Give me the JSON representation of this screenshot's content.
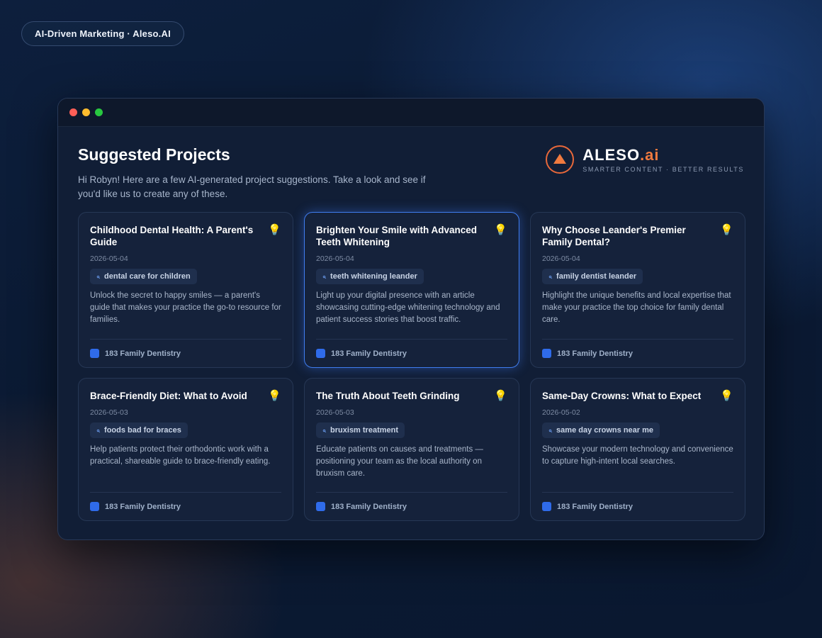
{
  "top_pill": {
    "label": "AI-Driven Marketing · Aleso.AI"
  },
  "window": {
    "traffic_lights": [
      "red",
      "yellow",
      "green"
    ]
  },
  "header": {
    "title": "Suggested Projects",
    "subtitle": "Hi Robyn! Here are a few AI-generated project suggestions. Take a look and see if you'd like us to create any of these."
  },
  "logo": {
    "name": "ALESO",
    "suffix": ".ai",
    "tagline": "SMARTER CONTENT · BETTER RESULTS",
    "icon": "triangle-logo-icon"
  },
  "colors": {
    "accent": "#3f7df0",
    "brand_orange": "#f07a3f",
    "card_bg": "#15223b",
    "window_bg": "#111e36"
  },
  "cards": [
    {
      "title": "Childhood Dental Health: A Parent's Guide",
      "date": "2026-05-04",
      "keyword": "dental care for children",
      "description": "Unlock the secret to happy smiles — a parent's guide that makes your practice the go-to resource for families.",
      "client": "183 Family Dentistry",
      "icon": "lightbulb-icon",
      "selected": false
    },
    {
      "title": "Brighten Your Smile with Advanced Teeth Whitening",
      "date": "2026-05-04",
      "keyword": "teeth whitening leander",
      "description": "Light up your digital presence with an article showcasing cutting-edge whitening technology and patient success stories that boost traffic.",
      "client": "183 Family Dentistry",
      "icon": "lightbulb-icon",
      "selected": true
    },
    {
      "title": "Why Choose Leander's Premier Family Dental?",
      "date": "2026-05-04",
      "keyword": "family dentist leander",
      "description": "Highlight the unique benefits and local expertise that make your practice the top choice for family dental care.",
      "client": "183 Family Dentistry",
      "icon": "lightbulb-icon",
      "selected": false
    },
    {
      "title": "Brace-Friendly Diet: What to Avoid",
      "date": "2026-05-03",
      "keyword": "foods bad for braces",
      "description": "Help patients protect their orthodontic work with a practical, shareable guide to brace-friendly eating.",
      "client": "183 Family Dentistry",
      "icon": "lightbulb-icon",
      "selected": false
    },
    {
      "title": "The Truth About Teeth Grinding",
      "date": "2026-05-03",
      "keyword": "bruxism treatment",
      "description": "Educate patients on causes and treatments — positioning your team as the local authority on bruxism care.",
      "client": "183 Family Dentistry",
      "icon": "lightbulb-icon",
      "selected": false
    },
    {
      "title": "Same-Day Crowns: What to Expect",
      "date": "2026-05-02",
      "keyword": "same day crowns near me",
      "description": "Showcase your modern technology and convenience to capture high-intent local searches.",
      "client": "183 Family Dentistry",
      "icon": "lightbulb-icon",
      "selected": false
    }
  ]
}
